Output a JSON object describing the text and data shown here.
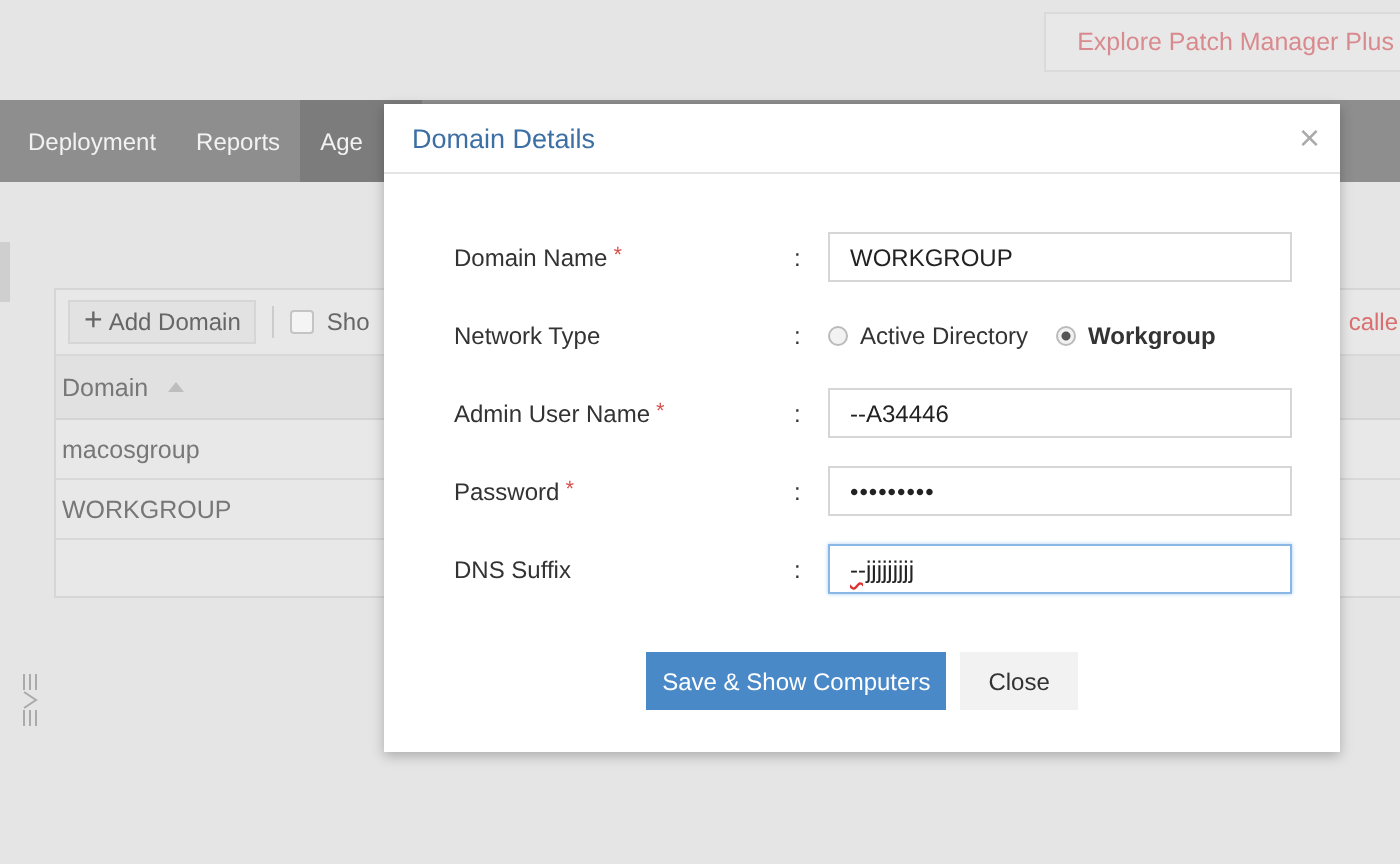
{
  "top_bar": {
    "explore_button": "Explore Patch Manager Plus"
  },
  "nav": {
    "tabs": [
      {
        "label": "Deployment",
        "selected": false
      },
      {
        "label": "Reports",
        "selected": false
      },
      {
        "label": "Age",
        "selected": true
      }
    ]
  },
  "toolbar": {
    "add_icon": "+",
    "add_button": "Add Domain",
    "checkbox": {
      "label": "Sho",
      "checked": false
    },
    "link": "calle"
  },
  "table": {
    "columns": [
      {
        "label": "Domain",
        "sorted": true
      }
    ],
    "rows": [
      "macosgroup",
      "WORKGROUP"
    ]
  },
  "dialog": {
    "title": "Domain Details",
    "close": "×",
    "required_mark": "*",
    "separator": ":",
    "fields": [
      {
        "label": "Domain Name",
        "required": true,
        "kind": "text",
        "value": "WORKGROUP",
        "focused": false
      },
      {
        "label": "Network Type",
        "required": false,
        "kind": "radio",
        "options": [
          {
            "label": "Active Directory",
            "selected": false
          },
          {
            "label": "Workgroup",
            "selected": true
          }
        ]
      },
      {
        "label": "Admin User Name",
        "required": true,
        "kind": "text",
        "value": "--A34446",
        "focused": false
      },
      {
        "label": "Password",
        "required": true,
        "kind": "password",
        "value": "•••••••••",
        "focused": false
      },
      {
        "label": "DNS Suffix",
        "required": false,
        "kind": "text",
        "value": "--jjjjjjjjj",
        "focused": true,
        "misspelled": true
      }
    ],
    "buttons": [
      {
        "label": "Save & Show Computers",
        "kind": "primary"
      },
      {
        "label": "Close",
        "kind": "secondary"
      }
    ]
  }
}
